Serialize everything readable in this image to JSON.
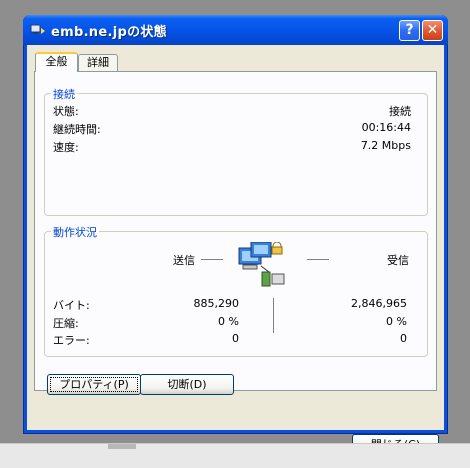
{
  "window": {
    "title": "emb.ne.jpの状態"
  },
  "titlebar_buttons": {
    "help": "?",
    "close": "✕"
  },
  "tabs": [
    {
      "label": "全般"
    },
    {
      "label": "詳細"
    }
  ],
  "connection": {
    "legend": "接続",
    "rows": [
      {
        "label": "状態:",
        "value": "接続"
      },
      {
        "label": "継続時間:",
        "value": "00:16:44"
      },
      {
        "label": "速度:",
        "value": "7.2 Mbps"
      }
    ]
  },
  "activity": {
    "legend": "動作状況",
    "sent_label": "送信",
    "received_label": "受信",
    "rows": [
      {
        "label": "バイト:",
        "sent": "885,290",
        "received": "2,846,965"
      },
      {
        "label": "圧縮:",
        "sent": "0 %",
        "received": "0 %"
      },
      {
        "label": "エラー:",
        "sent": "0",
        "received": "0"
      }
    ]
  },
  "buttons": {
    "properties": "プロパティ(P)",
    "disconnect": "切断(D)",
    "close": "閉じる(C)"
  }
}
